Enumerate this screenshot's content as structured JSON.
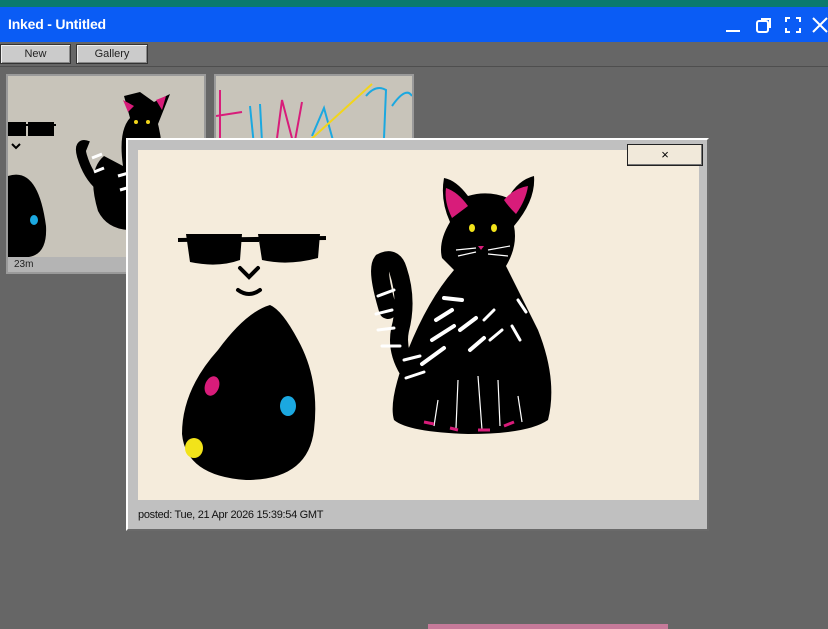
{
  "window": {
    "title": "Inked - Untitled",
    "controls": [
      "minimize-icon",
      "restore-icon",
      "fullscreen-icon",
      "close-icon"
    ],
    "accent_color": "#0a5cf5"
  },
  "toolbar": {
    "new_label": "New",
    "gallery_label": "Gallery"
  },
  "gallery": {
    "thumbnails": [
      {
        "time": "23m"
      },
      {
        "time": ""
      }
    ]
  },
  "viewer": {
    "close_label": "×",
    "posted": "posted: Tue, 21 Apr 2026 15:39:54 GMT",
    "canvas_background": "#f5ecdc"
  }
}
